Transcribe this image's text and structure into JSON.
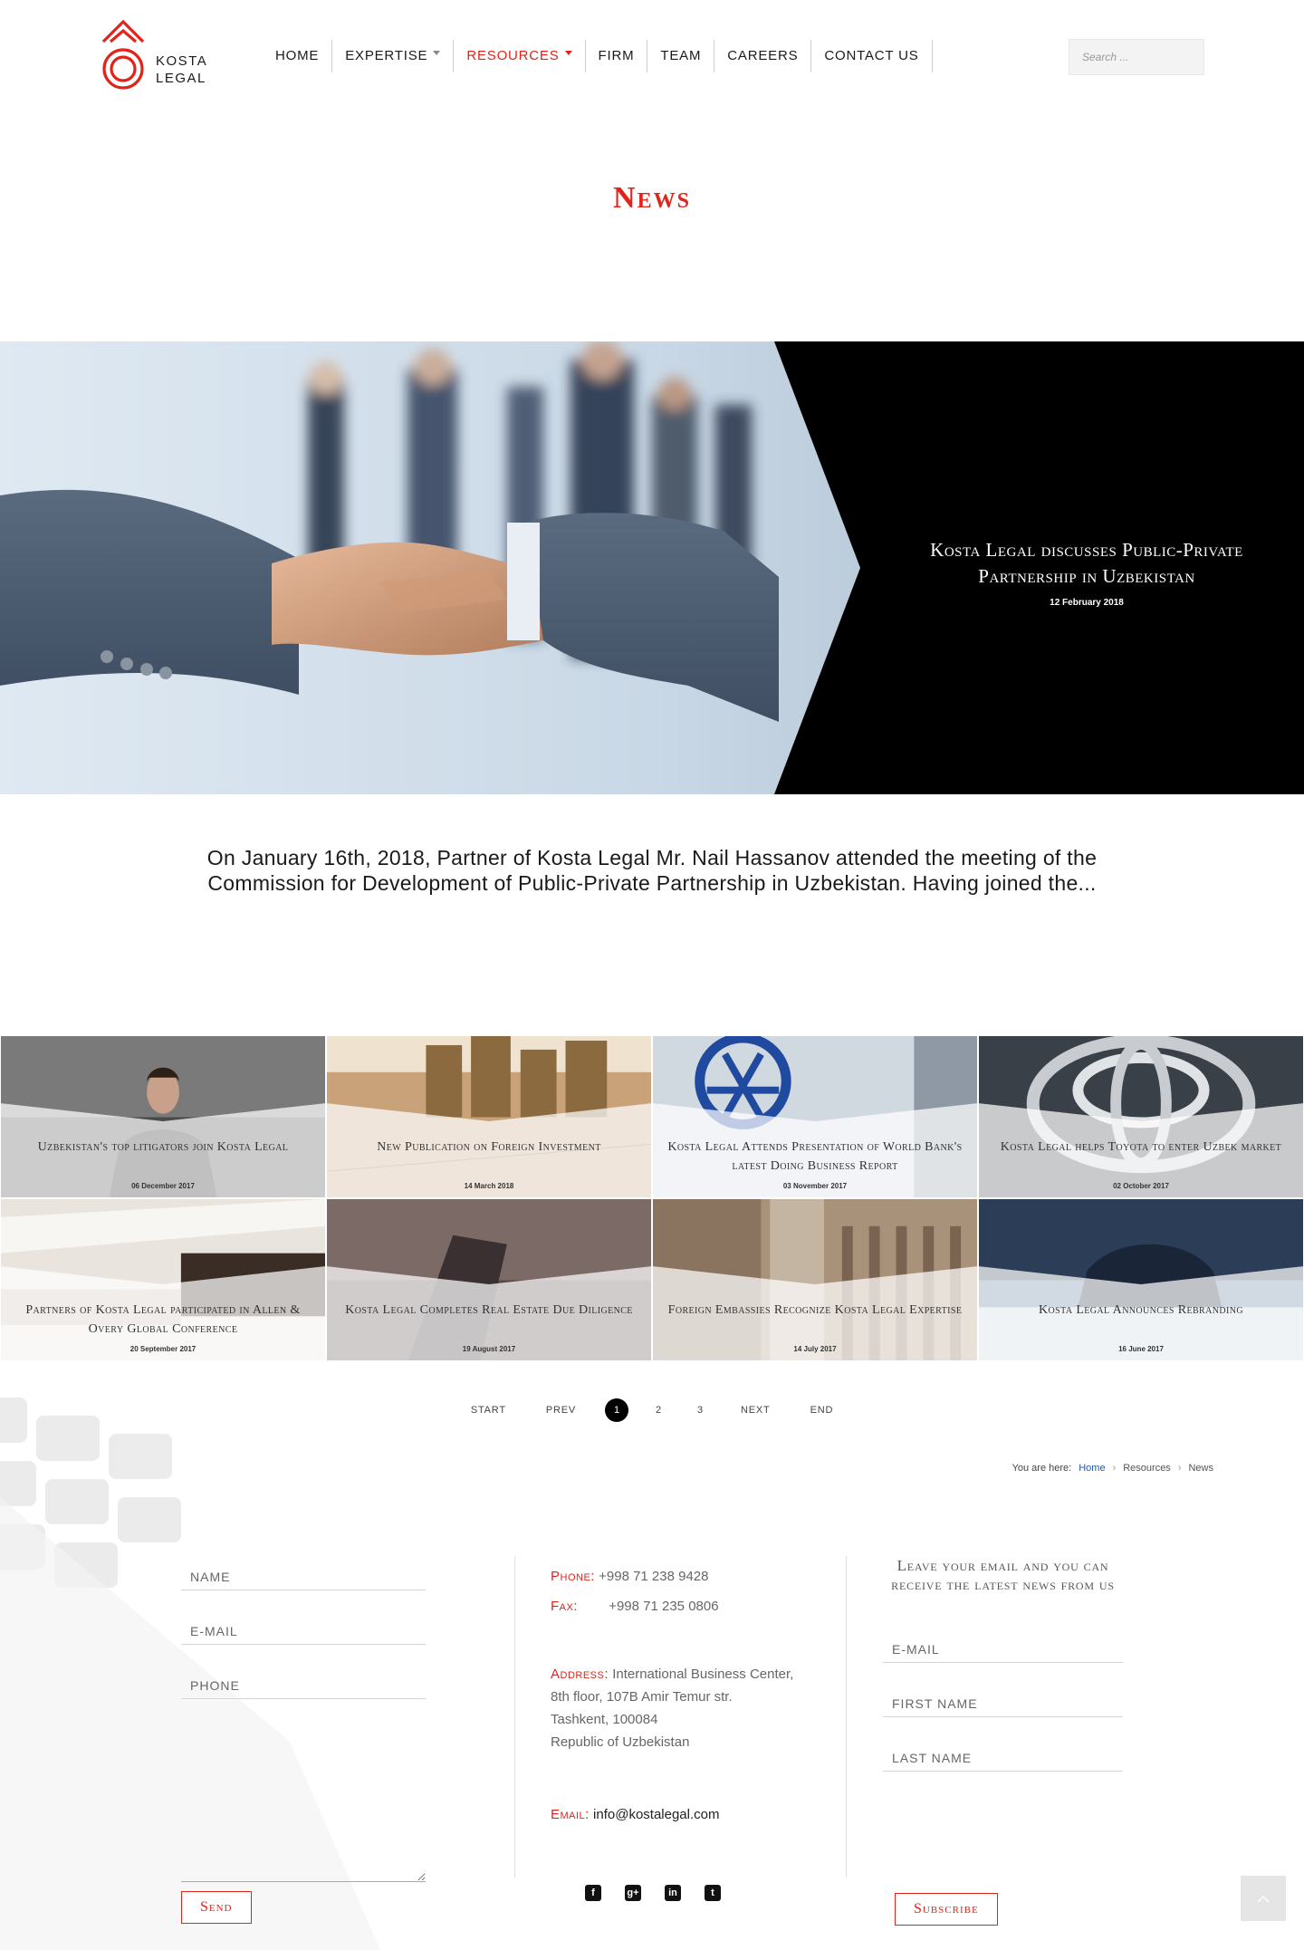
{
  "header": {
    "logo_text_line1": "KOSTA",
    "logo_text_line2": "LEGAL",
    "nav": {
      "home": "HOME",
      "expertise": "EXPERTISE",
      "resources": "RESOURCES",
      "firm": "FIRM",
      "team": "TEAM",
      "careers": "CAREERS",
      "contact": "CONTACT US"
    },
    "search_placeholder": "Search ..."
  },
  "page_title": "News",
  "hero": {
    "title": "Kosta Legal discusses Public-Private Partnership in Uzbekistan",
    "date": "12 February 2018"
  },
  "intro_text": "On January 16th, 2018, Partner of Kosta Legal Mr. Nail Hassanov attended the meeting of the Commission for Development of Public-Private Partnership in Uzbekistan. Having joined the...",
  "news": [
    {
      "title": "Uzbekistan's top litigators join Kosta Legal",
      "date": "06 December 2017"
    },
    {
      "title": "New Publication on Foreign Investment",
      "date": "14 March 2018"
    },
    {
      "title": "Kosta Legal Attends Presentation of World Bank's latest Doing Business Report",
      "date": "03 November 2017"
    },
    {
      "title": "Kosta Legal helps Toyota to enter Uzbek market",
      "date": "02 October 2017"
    },
    {
      "title": "Partners of Kosta Legal participated in Allen & Overy Global Conference",
      "date": "20 September 2017"
    },
    {
      "title": "Kosta Legal Completes Real Estate Due Diligence",
      "date": "19 August 2017"
    },
    {
      "title": "Foreign Embassies Recognize Kosta Legal Expertise",
      "date": "14 July 2017"
    },
    {
      "title": "Kosta Legal Announces Rebranding",
      "date": "16 June 2017"
    }
  ],
  "pagination": {
    "start": "START",
    "prev": "PREV",
    "pages": [
      "1",
      "2",
      "3"
    ],
    "next": "NEXT",
    "end": "END"
  },
  "breadcrumb": {
    "prefix": "You are here:",
    "home": "Home",
    "resources": "Resources",
    "current": "News"
  },
  "footer": {
    "form": {
      "name_placeholder": "NAME",
      "email_placeholder": "E-MAIL",
      "phone_placeholder": "PHONE",
      "send_label": "Send"
    },
    "contact": {
      "phone_label": "Phone:",
      "phone": "+998 71 238 9428",
      "fax_label": "Fax:",
      "fax": "+998 71 235 0806",
      "address_label": "Address:",
      "address_line1": "International Business Center,",
      "address_line2": "8th floor, 107B Amir Temur str.",
      "address_line3": "Tashkent, 100084",
      "address_line4": "Republic of Uzbekistan",
      "email_label": "Email:",
      "email": "info@kostalegal.com"
    },
    "social_icons": [
      "facebook-icon",
      "google-plus-icon",
      "linkedin-icon",
      "twitter-icon"
    ],
    "newsletter": {
      "text": "Leave your email and you can receive the latest news from us",
      "email_placeholder": "E-MAIL",
      "first_name_placeholder": "FIRST NAME",
      "last_name_placeholder": "LAST NAME",
      "subscribe_label": "Subscribe"
    }
  },
  "colors": {
    "accent": "#e2231a",
    "hero_panel": "#000000"
  }
}
